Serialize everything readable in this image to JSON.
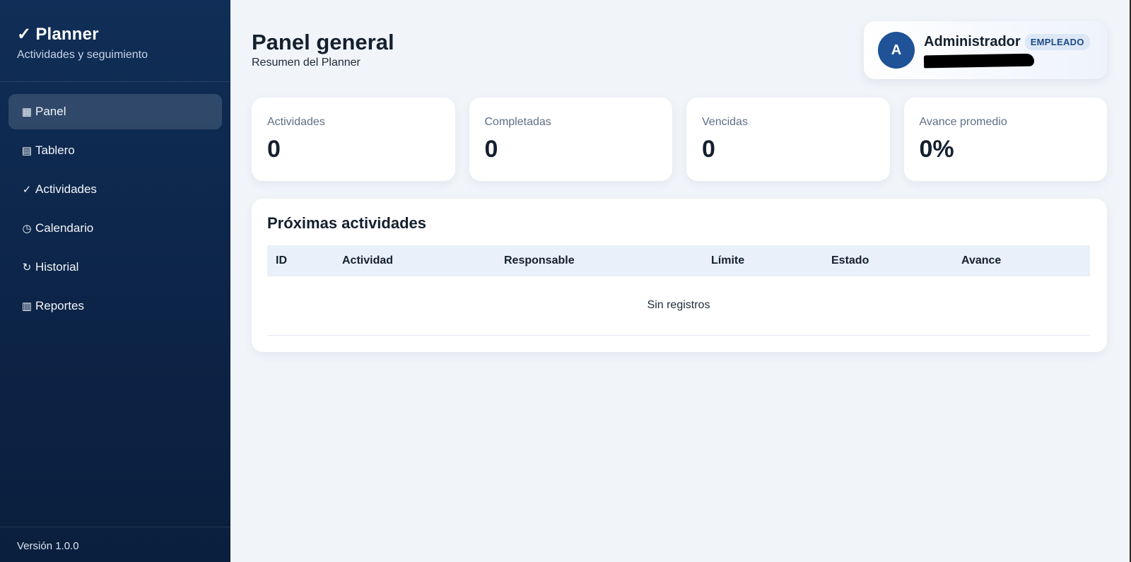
{
  "sidebar": {
    "brand_check": "✓",
    "brand_title": "Planner",
    "brand_subtitle": "Actividades y seguimiento",
    "items": [
      {
        "icon": "▦",
        "label": "Panel",
        "active": true
      },
      {
        "icon": "▤",
        "label": "Tablero"
      },
      {
        "icon": "✓",
        "label": "Actividades"
      },
      {
        "icon": "◷",
        "label": "Calendario"
      },
      {
        "icon": "↻",
        "label": "Historial"
      },
      {
        "icon": "▥",
        "label": "Reportes"
      }
    ],
    "version": "Versión 1.0.0"
  },
  "header": {
    "title": "Panel general",
    "subtitle": "Resumen del Planner"
  },
  "user": {
    "initial": "A",
    "name": "Administrador",
    "role": "EMPLEADO"
  },
  "stats": [
    {
      "label": "Actividades",
      "value": "0"
    },
    {
      "label": "Completadas",
      "value": "0"
    },
    {
      "label": "Vencidas",
      "value": "0"
    },
    {
      "label": "Avance promedio",
      "value": "0%"
    }
  ],
  "upcoming": {
    "title": "Próximas actividades",
    "columns": [
      "ID",
      "Actividad",
      "Responsable",
      "Límite",
      "Estado",
      "Avance"
    ],
    "empty_text": "Sin registros"
  }
}
